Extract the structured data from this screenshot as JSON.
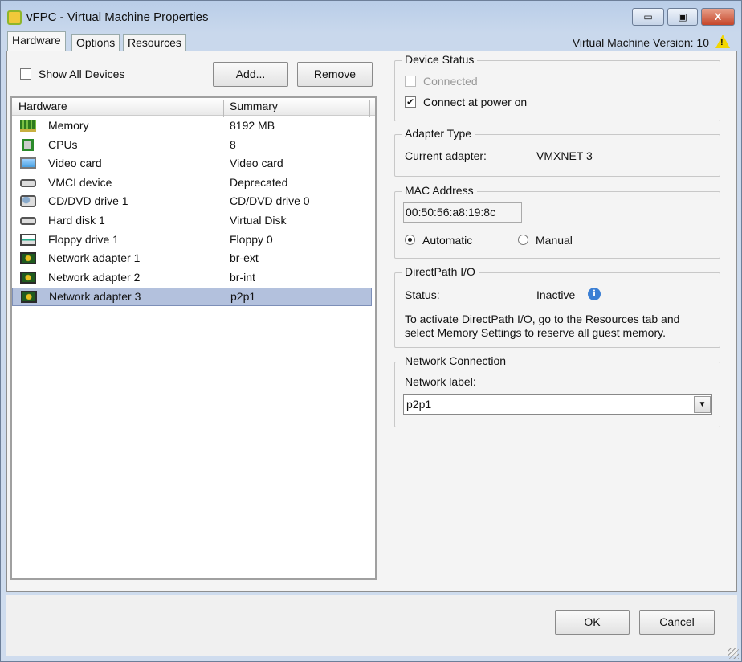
{
  "window": {
    "title": "vFPC - Virtual Machine Properties",
    "minimize": "▭",
    "maximize": "▣",
    "close": "X"
  },
  "tabs": [
    "Hardware",
    "Options",
    "Resources"
  ],
  "version": "Virtual Machine Version: 10",
  "left": {
    "show_all": "Show All Devices",
    "add": "Add...",
    "remove": "Remove",
    "columns": [
      "Hardware",
      "Summary"
    ],
    "rows": [
      {
        "name": "Memory",
        "summary": "8192 MB",
        "icon": "memory-icon"
      },
      {
        "name": "CPUs",
        "summary": "8",
        "icon": "cpu-icon"
      },
      {
        "name": "Video card",
        "summary": "Video card",
        "icon": "monitor-icon"
      },
      {
        "name": "VMCI device",
        "summary": "Deprecated",
        "icon": "device-icon"
      },
      {
        "name": "CD/DVD drive 1",
        "summary": "CD/DVD drive 0",
        "icon": "cd-drive-icon"
      },
      {
        "name": "Hard disk 1",
        "summary": "Virtual Disk",
        "icon": "hard-disk-icon"
      },
      {
        "name": "Floppy drive 1",
        "summary": "Floppy 0",
        "icon": "floppy-icon"
      },
      {
        "name": "Network adapter 1",
        "summary": "br-ext",
        "icon": "network-adapter-icon"
      },
      {
        "name": "Network adapter 2",
        "summary": "br-int",
        "icon": "network-adapter-icon"
      },
      {
        "name": "Network adapter 3",
        "summary": "p2p1",
        "icon": "network-adapter-icon"
      }
    ],
    "selected": 9
  },
  "device_status": {
    "title": "Device Status",
    "connected": "Connected",
    "connect_power_on": "Connect at power on"
  },
  "adapter_type": {
    "title": "Adapter Type",
    "label": "Current adapter:",
    "value": "VMXNET 3"
  },
  "mac": {
    "title": "MAC Address",
    "value": "00:50:56:a8:19:8c",
    "automatic": "Automatic",
    "manual": "Manual"
  },
  "directpath": {
    "title": "DirectPath I/O",
    "status_label": "Status:",
    "status": "Inactive",
    "line1": "To activate DirectPath I/O, go to the Resources tab and",
    "line2": "select Memory Settings to reserve all guest memory."
  },
  "network": {
    "title": "Network Connection",
    "label": "Network label:",
    "value": "p2p1"
  },
  "footer": {
    "ok": "OK",
    "cancel": "Cancel"
  }
}
